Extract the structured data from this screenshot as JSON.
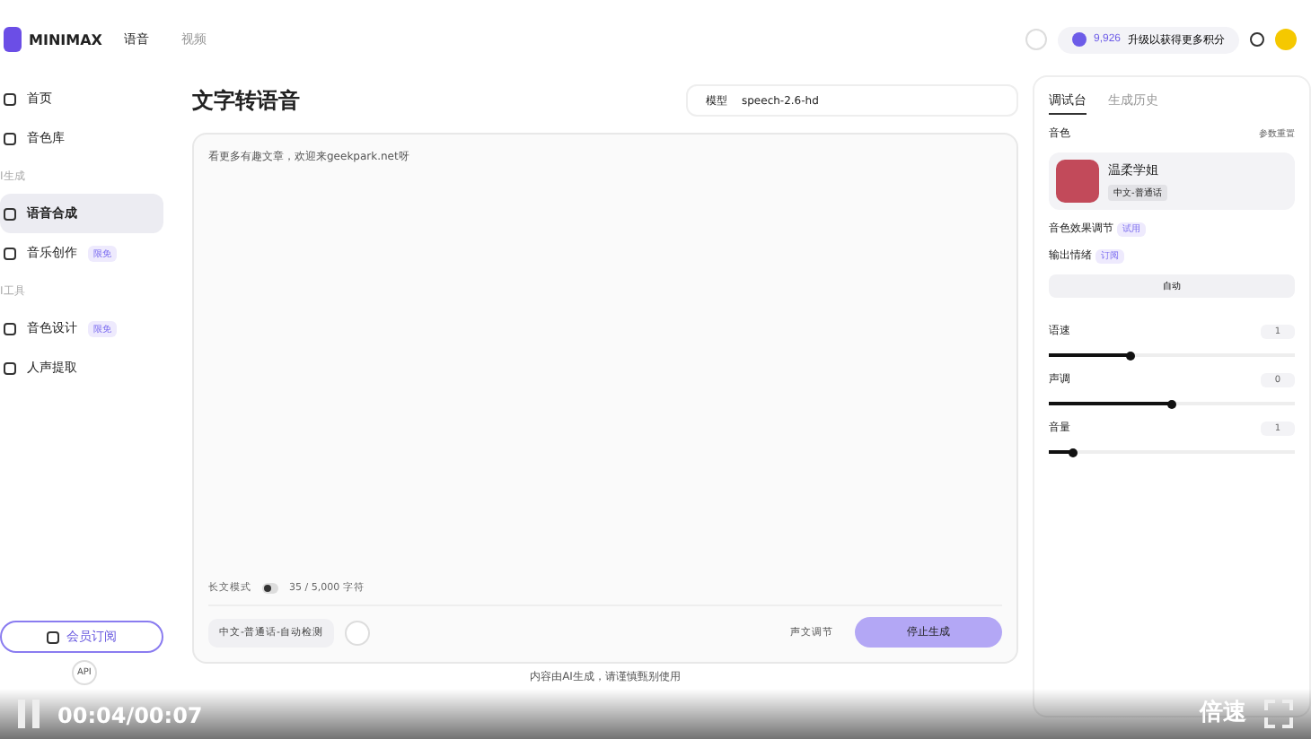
{
  "topbar": {
    "logo": "MINIMAX",
    "nav": [
      {
        "label": "语音",
        "selected": true
      },
      {
        "label": "视频",
        "selected": false
      }
    ],
    "credits": "9,926",
    "upgrade": "升级以获得更多积分"
  },
  "sidebar": {
    "items": [
      {
        "kind": "item",
        "label": "首页",
        "selected": false
      },
      {
        "kind": "item",
        "label": "音色库",
        "selected": false
      },
      {
        "kind": "section",
        "label": "I生成"
      },
      {
        "kind": "item",
        "label": "语音合成",
        "selected": true
      },
      {
        "kind": "item",
        "label": "音乐创作",
        "selected": false,
        "badge": "限免"
      },
      {
        "kind": "section",
        "label": "I工具"
      },
      {
        "kind": "item",
        "label": "音色设计",
        "selected": false,
        "badge": "限免"
      },
      {
        "kind": "item",
        "label": "人声提取",
        "selected": false
      }
    ],
    "subscribe": "会员订阅",
    "footer_api": "API"
  },
  "main": {
    "title": "文字转语音",
    "model_label": "模型",
    "model": "speech-2.6-hd",
    "text": "看更多有趣文章，欢迎来geekpark.net呀",
    "long_mode": {
      "label": "长文模式",
      "on": false
    },
    "count": "35 / 5,000 字符",
    "language": "中文-普通话-自动检测",
    "adjust": "声文调节",
    "generate": "停止生成",
    "disclaimer": "内容由AI生成，请谨慎甄别使用"
  },
  "panel": {
    "tabs": [
      {
        "label": "调试台",
        "selected": true
      },
      {
        "label": "生成历史",
        "selected": false
      }
    ],
    "voice_label": "音色",
    "reset": "参数重置",
    "voice_name": "温柔学姐",
    "voice_tag": "中文-普通话",
    "effect": "音色效果调节",
    "effect_badge": "试用",
    "emotion": "输出情绪",
    "emotion_badge": "订阅",
    "emotion_value": "自动",
    "sliders": [
      {
        "name": "语速",
        "reading": "1",
        "level": 0.33
      },
      {
        "name": "声调",
        "reading": "0",
        "level": 0.5
      },
      {
        "name": "音量",
        "reading": "1",
        "level": 0.1
      }
    ]
  },
  "player": {
    "time": "00:04/00:07",
    "speed": "倍速"
  }
}
